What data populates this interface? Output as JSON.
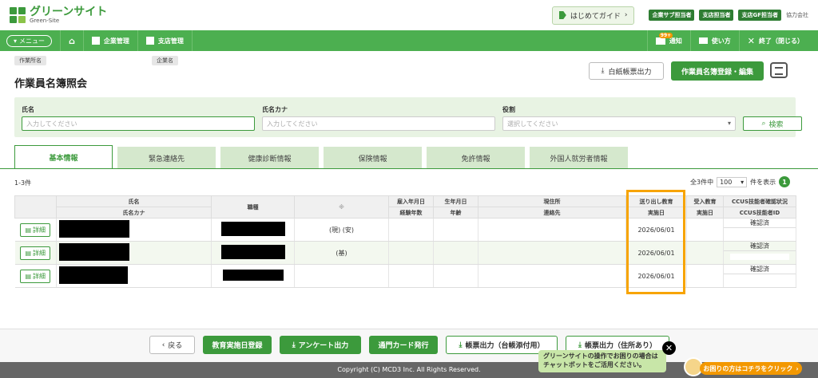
{
  "brand": {
    "title": "グリーンサイト",
    "subtitle": "Green-Site"
  },
  "top": {
    "guide": "はじめてガイド",
    "guide_arrow": "›",
    "roles": [
      "企業サブ担当者",
      "支店担当者",
      "支店GF担当者"
    ],
    "company": "協力会社"
  },
  "nav": {
    "menu": "メニュー",
    "items": [
      "企業管理",
      "支店管理"
    ],
    "right": {
      "notice": "通知",
      "notice_badge": "99+",
      "howto": "使い方",
      "exit": "終了（閉じる）"
    }
  },
  "header": {
    "chip1": "作業所名",
    "chip2": "企業名",
    "title": "作業員名簿照会",
    "blank_btn": "白紙帳票出力",
    "register_btn": "作業員名簿登録・編集"
  },
  "search": {
    "name_label": "氏名",
    "name_ph": "入力してください",
    "kana_label": "氏名カナ",
    "kana_ph": "入力してください",
    "role_label": "役割",
    "role_ph": "選択してください",
    "btn": "検索"
  },
  "tabs": [
    "基本情報",
    "緊急連絡先",
    "健康診断情報",
    "保険情報",
    "免許情報",
    "外国人就労者情報"
  ],
  "list": {
    "count": "1-3件",
    "total": "全3件中",
    "per_page": "100",
    "per_page_suffix": "件を表示",
    "page": "1"
  },
  "table": {
    "headers": {
      "name": "氏名",
      "kana": "氏名カナ",
      "job": "職種",
      "mark": "※",
      "hire": "雇入年月日",
      "exp": "経験年数",
      "birth": "生年月日",
      "age": "年齢",
      "addr": "現住所",
      "contact": "連絡先",
      "send_edu": "送り出し教育",
      "send_edu2": "実施日",
      "recv_edu": "受入教育",
      "recv_edu2": "実施日",
      "ccus": "CCUS技能者確認状況",
      "ccus2": "CCUS技能者ID"
    },
    "rows": [
      {
        "detail": "詳細",
        "mark": "(現) (安)",
        "send_date": "2026/06/01",
        "ccus": "確認済"
      },
      {
        "detail": "詳細",
        "mark": "(基)",
        "send_date": "2026/06/01",
        "ccus": "確認済"
      },
      {
        "detail": "詳細",
        "mark": "",
        "send_date": "2026/06/01",
        "ccus": "確認済"
      }
    ]
  },
  "footer_buttons": {
    "back": "戻る",
    "edu_reg": "教育実施日登録",
    "survey": "アンケート出力",
    "gate": "通門カード発行",
    "form_ledger": "帳票出力（台帳添付用）",
    "form_addr": "帳票出力（住所あり）"
  },
  "chatbot": {
    "bubble": "グリーンサイトの操作でお困りの場合はチャットボットをご活用ください。",
    "help": "お困りの方はコチラをクリック",
    "help_arrow": "›"
  },
  "copyright": "Copyright (C) MCD3 Inc. All Rights Reserved.",
  "colors": {
    "brand_green": "#3c9a3c",
    "nav_green": "#4caf50",
    "highlight": "#f7a400"
  }
}
